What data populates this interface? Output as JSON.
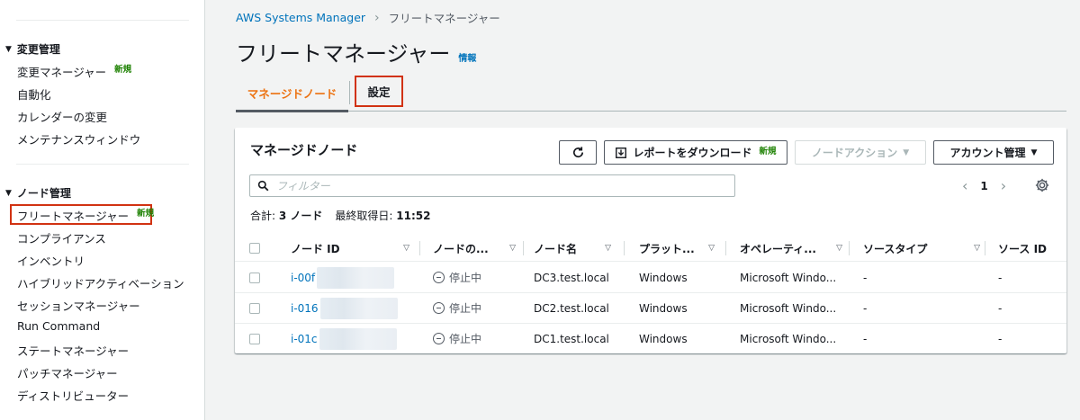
{
  "breadcrumb": {
    "root": "AWS Systems Manager",
    "current": "フリートマネージャー"
  },
  "page": {
    "title": "フリートマネージャー",
    "info": "情報"
  },
  "tabs": {
    "managed_nodes": "マネージドノード",
    "settings": "設定"
  },
  "sidebar": {
    "change_section": "変更管理",
    "change_items": [
      "変更マネージャー",
      "自動化",
      "カレンダーの変更",
      "メンテナンスウィンドウ"
    ],
    "node_section": "ノード管理",
    "node_items": [
      "フリートマネージャー",
      "コンプライアンス",
      "インベントリ",
      "ハイブリッドアクティベーション",
      "セッションマネージャー",
      "Run Command",
      "ステートマネージャー",
      "パッチマネージャー",
      "ディストリビューター"
    ],
    "new_badge": "新規"
  },
  "panel": {
    "title": "マネージドノード",
    "report_button": "レポートをダウンロード",
    "node_action_button": "ノードアクション",
    "account_button": "アカウント管理",
    "filter_placeholder": "フィルター",
    "page_number": "1",
    "summary_total_label": "合計:",
    "summary_total_value": "3 ノード",
    "summary_last_label": "最終取得日:",
    "summary_last_value": "11:52"
  },
  "table": {
    "headers": [
      "ノード ID",
      "ノードの...",
      "ノード名",
      "プラット...",
      "オペレーティ...",
      "ソースタイプ",
      "ソース ID"
    ],
    "rows": [
      {
        "id": "i-00f",
        "status": "停止中",
        "name": "DC3.test.local",
        "platform": "Windows",
        "os": "Microsoft Windo...",
        "source_type": "-",
        "source_id": "-"
      },
      {
        "id": "i-016",
        "status": "停止中",
        "name": "DC2.test.local",
        "platform": "Windows",
        "os": "Microsoft Windo...",
        "source_type": "-",
        "source_id": "-"
      },
      {
        "id": "i-01c",
        "status": "停止中",
        "name": "DC1.test.local",
        "platform": "Windows",
        "os": "Microsoft Windo...",
        "source_type": "-",
        "source_id": "-"
      }
    ]
  },
  "colors": {
    "link": "#0073bb",
    "accent": "#ec7211",
    "highlight": "#d13212",
    "new": "#1d8102"
  }
}
